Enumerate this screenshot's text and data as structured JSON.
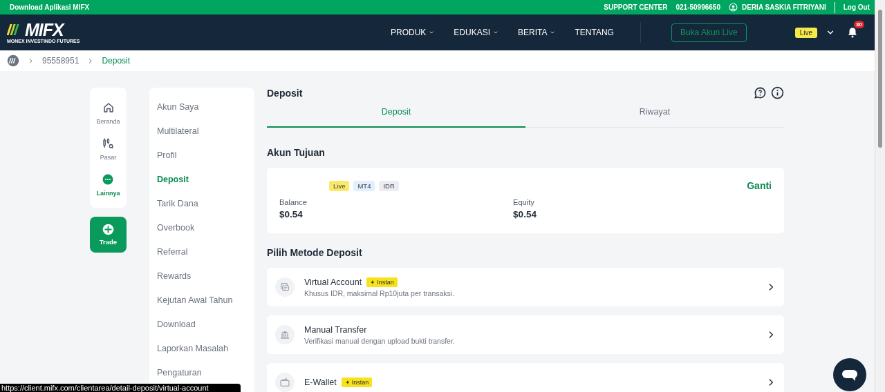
{
  "top_bar": {
    "download_label": "Download Aplikasi MIFX",
    "support": "SUPPORT CENTER",
    "phone": "021-50996650",
    "user_name": "DERIA SASKIA FITRIYANI",
    "logout": "Log Out"
  },
  "navbar": {
    "logo_text": "MIFX",
    "logo_tagline": "MONEX INVESTINDO FUTURES",
    "menu": [
      {
        "label": "PRODUK",
        "dropdown": true
      },
      {
        "label": "EDUKASI",
        "dropdown": true
      },
      {
        "label": "BERITA",
        "dropdown": true
      },
      {
        "label": "TENTANG",
        "dropdown": false
      }
    ],
    "open_account_button": "Buka Akun Live",
    "account_badge": "Live",
    "notification_count": "30"
  },
  "breadcrumb": {
    "items": [
      "95558951",
      "Deposit"
    ]
  },
  "rail": [
    {
      "label": "Beranda",
      "kind": "home",
      "selected": false
    },
    {
      "label": "Pasar",
      "kind": "market",
      "selected": false
    },
    {
      "label": "Lainnya",
      "kind": "more",
      "selected": true
    }
  ],
  "trade_button": "Trade",
  "side_menu": [
    {
      "label": "Akun Saya",
      "selected": false
    },
    {
      "label": "Multilateral",
      "selected": false
    },
    {
      "label": "Profil",
      "selected": false
    },
    {
      "label": "Deposit",
      "selected": true
    },
    {
      "label": "Tarik Dana",
      "selected": false
    },
    {
      "label": "Overbook",
      "selected": false
    },
    {
      "label": "Referral",
      "selected": false
    },
    {
      "label": "Rewards",
      "selected": false
    },
    {
      "label": "Kejutan Awal Tahun",
      "selected": false
    },
    {
      "label": "Download",
      "selected": false
    },
    {
      "label": "Laporkan Masalah",
      "selected": false
    },
    {
      "label": "Pengaturan",
      "selected": false
    }
  ],
  "main": {
    "title": "Deposit",
    "tabs": [
      {
        "label": "Deposit",
        "selected": true
      },
      {
        "label": "Riwayat",
        "selected": false
      }
    ],
    "account_heading": "Akun Tujuan",
    "account": {
      "tags": [
        {
          "label": "Live",
          "color": "#fbe96a"
        },
        {
          "label": "MT4",
          "color": "#e3effb"
        },
        {
          "label": "IDR",
          "color": "#ecedf1"
        }
      ],
      "change_link": "Ganti",
      "balance_label": "Balance",
      "balance": "$0.54",
      "equity_label": "Equity",
      "equity": "$0.54"
    },
    "methods_heading": "Pilih Metode Deposit",
    "methods": [
      {
        "kind": "card",
        "name": "Virtual Account",
        "instant_badge": "Instan",
        "description": "Khusus IDR, maksimal Rp10juta per transaksi."
      },
      {
        "kind": "bank",
        "name": "Manual Transfer",
        "description": "Verifikasi manual dengan upload bukti transfer."
      },
      {
        "kind": "wallet",
        "name": "E-Wallet",
        "instant_badge": "Instan"
      }
    ]
  },
  "status_url": "https://client.mifx.com/clientarea/detail-deposit/virtual-account"
}
